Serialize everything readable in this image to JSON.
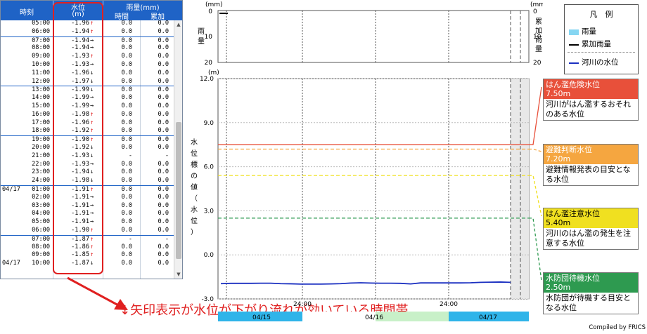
{
  "table": {
    "headers": {
      "time": "時刻",
      "level": "水位",
      "level_unit": "(m)",
      "rain": "雨量(mm)",
      "hourly": "時間",
      "cumulative": "累加"
    },
    "rows": [
      {
        "date": "",
        "time": "05:00",
        "level": "-1.96",
        "trend": "↑",
        "hourly": "0.0",
        "cumulative": "0.0",
        "sep": false
      },
      {
        "date": "",
        "time": "06:00",
        "level": "-1.94",
        "trend": "↑",
        "hourly": "0.0",
        "cumulative": "0.0",
        "sep": false
      },
      {
        "date": "",
        "time": "07:00",
        "level": "-1.94",
        "trend": "→",
        "hourly": "0.0",
        "cumulative": "0.0",
        "sep": true
      },
      {
        "date": "",
        "time": "08:00",
        "level": "-1.94",
        "trend": "→",
        "hourly": "0.0",
        "cumulative": "0.0",
        "sep": false
      },
      {
        "date": "",
        "time": "09:00",
        "level": "-1.93",
        "trend": "↑",
        "hourly": "0.0",
        "cumulative": "0.0",
        "sep": false
      },
      {
        "date": "",
        "time": "10:00",
        "level": "-1.93",
        "trend": "→",
        "hourly": "0.0",
        "cumulative": "0.0",
        "sep": false
      },
      {
        "date": "",
        "time": "11:00",
        "level": "-1.96",
        "trend": "↓",
        "hourly": "0.0",
        "cumulative": "0.0",
        "sep": false
      },
      {
        "date": "",
        "time": "12:00",
        "level": "-1.97",
        "trend": "↓",
        "hourly": "0.0",
        "cumulative": "0.0",
        "sep": false
      },
      {
        "date": "",
        "time": "13:00",
        "level": "-1.99",
        "trend": "↓",
        "hourly": "0.0",
        "cumulative": "0.0",
        "sep": true
      },
      {
        "date": "",
        "time": "14:00",
        "level": "-1.99",
        "trend": "→",
        "hourly": "0.0",
        "cumulative": "0.0",
        "sep": false
      },
      {
        "date": "",
        "time": "15:00",
        "level": "-1.99",
        "trend": "→",
        "hourly": "0.0",
        "cumulative": "0.0",
        "sep": false
      },
      {
        "date": "",
        "time": "16:00",
        "level": "-1.98",
        "trend": "↑",
        "hourly": "0.0",
        "cumulative": "0.0",
        "sep": false
      },
      {
        "date": "",
        "time": "17:00",
        "level": "-1.96",
        "trend": "↑",
        "hourly": "0.0",
        "cumulative": "0.0",
        "sep": false
      },
      {
        "date": "",
        "time": "18:00",
        "level": "-1.92",
        "trend": "↑",
        "hourly": "0.0",
        "cumulative": "0.0",
        "sep": false
      },
      {
        "date": "",
        "time": "19:00",
        "level": "-1.90",
        "trend": "↑",
        "hourly": "0.0",
        "cumulative": "0.0",
        "sep": true
      },
      {
        "date": "",
        "time": "20:00",
        "level": "-1.92",
        "trend": "↓",
        "hourly": "0.0",
        "cumulative": "0.0",
        "sep": false
      },
      {
        "date": "",
        "time": "21:00",
        "level": "-1.93",
        "trend": "↓",
        "hourly": "-",
        "cumulative": "-",
        "sep": false
      },
      {
        "date": "",
        "time": "22:00",
        "level": "-1.93",
        "trend": "→",
        "hourly": "0.0",
        "cumulative": "0.0",
        "sep": false
      },
      {
        "date": "",
        "time": "23:00",
        "level": "-1.94",
        "trend": "↓",
        "hourly": "0.0",
        "cumulative": "0.0",
        "sep": false
      },
      {
        "date": "",
        "time": "24:00",
        "level": "-1.98",
        "trend": "↓",
        "hourly": "0.0",
        "cumulative": "0.0",
        "sep": false
      },
      {
        "date": "04/17",
        "time": "01:00",
        "level": "-1.91",
        "trend": "↑",
        "hourly": "0.0",
        "cumulative": "0.0",
        "sep": true
      },
      {
        "date": "",
        "time": "02:00",
        "level": "-1.91",
        "trend": "→",
        "hourly": "0.0",
        "cumulative": "0.0",
        "sep": false
      },
      {
        "date": "",
        "time": "03:00",
        "level": "-1.91",
        "trend": "→",
        "hourly": "0.0",
        "cumulative": "0.0",
        "sep": false
      },
      {
        "date": "",
        "time": "04:00",
        "level": "-1.91",
        "trend": "→",
        "hourly": "0.0",
        "cumulative": "0.0",
        "sep": false
      },
      {
        "date": "",
        "time": "05:00",
        "level": "-1.91",
        "trend": "→",
        "hourly": "0.0",
        "cumulative": "0.0",
        "sep": false
      },
      {
        "date": "",
        "time": "06:00",
        "level": "-1.90",
        "trend": "↑",
        "hourly": "0.0",
        "cumulative": "0.0",
        "sep": false
      },
      {
        "date": "",
        "time": "07:00",
        "level": "-1.87",
        "trend": "↑",
        "hourly": "-",
        "cumulative": "-",
        "sep": true
      },
      {
        "date": "",
        "time": "08:00",
        "level": "-1.86",
        "trend": "↑",
        "hourly": "0.0",
        "cumulative": "0.0",
        "sep": false
      },
      {
        "date": "",
        "time": "09:00",
        "level": "-1.85",
        "trend": "↑",
        "hourly": "0.0",
        "cumulative": "0.0",
        "sep": false
      },
      {
        "date": "04/17",
        "time": "10:00",
        "level": "-1.87",
        "trend": "↓",
        "hourly": "0.0",
        "cumulative": "0.0",
        "sep": false
      }
    ]
  },
  "annotation": {
    "text": "↓矢印表示が水位が下がり流れが効いている時間帯"
  },
  "chart_data": {
    "type": "line",
    "rain_panel": {
      "left_unit": "(mm)",
      "right_unit": "(mm)",
      "left_label": "雨量",
      "right_label": "累加雨量",
      "left_ticks": [
        "0",
        "10",
        "20"
      ],
      "right_ticks": [
        "0",
        "10",
        "20"
      ],
      "ylim": [
        0,
        20
      ]
    },
    "level_panel": {
      "unit": "(m)",
      "ylabel": "水位標の値（水位）",
      "yticks": [
        "12.0",
        "9.0",
        "6.0",
        "3.0",
        "0.0",
        "-3.0"
      ],
      "ylim": [
        -3,
        12
      ]
    },
    "x_ticks": [
      "24:00",
      "24:00"
    ],
    "date_labels": [
      "04/15",
      "04/16",
      "04/17"
    ],
    "series": [
      {
        "name": "河川の水位",
        "color": "#1a2fc0",
        "values": [
          -1.96,
          -1.94,
          -1.94,
          -1.94,
          -1.93,
          -1.93,
          -1.96,
          -1.97,
          -1.99,
          -1.99,
          -1.99,
          -1.98,
          -1.96,
          -1.92,
          -1.9,
          -1.92,
          -1.93,
          -1.93,
          -1.94,
          -1.98,
          -1.91,
          -1.91,
          -1.91,
          -1.91,
          -1.91,
          -1.9,
          -1.87,
          -1.86,
          -1.85,
          -1.87
        ]
      }
    ],
    "thresholds": [
      {
        "value": 7.5,
        "color": "#e8503a"
      },
      {
        "value": 7.2,
        "color": "#f5a640"
      },
      {
        "value": 5.4,
        "color": "#f0e020"
      },
      {
        "value": 2.5,
        "color": "#2e9a50"
      }
    ]
  },
  "legend": {
    "title": "凡　例",
    "items": [
      {
        "label": "雨量",
        "color": "#86d6f2"
      },
      {
        "label": "累加雨量",
        "color": "#000000"
      },
      {
        "label": "河川の水位",
        "color": "#1a2fc0"
      }
    ]
  },
  "thresholds": [
    {
      "name": "はん濫危険水位",
      "value": "7.50m",
      "desc": "河川がはん濫するおそれのある水位",
      "color": "#e8503a"
    },
    {
      "name": "避難判断水位",
      "value": "7.20m",
      "desc": "避難情報発表の目安となる水位",
      "color": "#f5a640"
    },
    {
      "name": "はん濫注意水位",
      "value": "5.40m",
      "desc": "河川のはん濫の発生を注意する水位",
      "color": "#f0e020"
    },
    {
      "name": "水防団待機水位",
      "value": "2.50m",
      "desc": "水防団が待機する目安となる水位",
      "color": "#2e9a50"
    }
  ],
  "credit": "Compiled by FRICS"
}
